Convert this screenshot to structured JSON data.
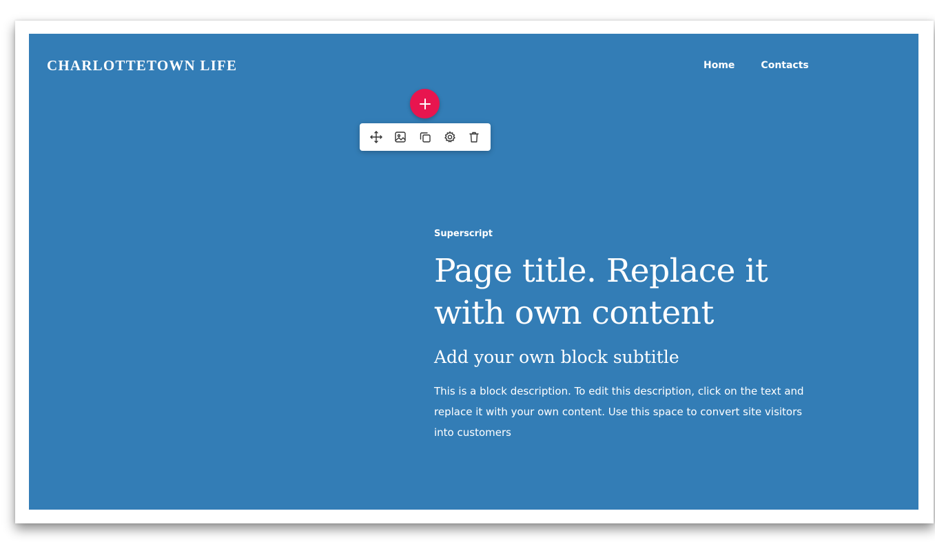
{
  "header": {
    "logo": "CHARLOTTETOWN LIFE",
    "nav": [
      "Home",
      "Contacts"
    ]
  },
  "editor": {
    "add_label": "+",
    "toolbar_icons": [
      "move-icon",
      "image-icon",
      "duplicate-icon",
      "settings-icon",
      "delete-icon"
    ]
  },
  "hero": {
    "superscript": "Superscript",
    "title": "Page title. Replace it with own content",
    "subtitle": "Add your own block subtitle",
    "description": "This is a block description. To edit this description, click on the text and replace it with your own content. Use this space to convert site visitors into customers"
  },
  "colors": {
    "background": "#337db6",
    "accent": "#e8154f",
    "text": "#ffffff"
  }
}
